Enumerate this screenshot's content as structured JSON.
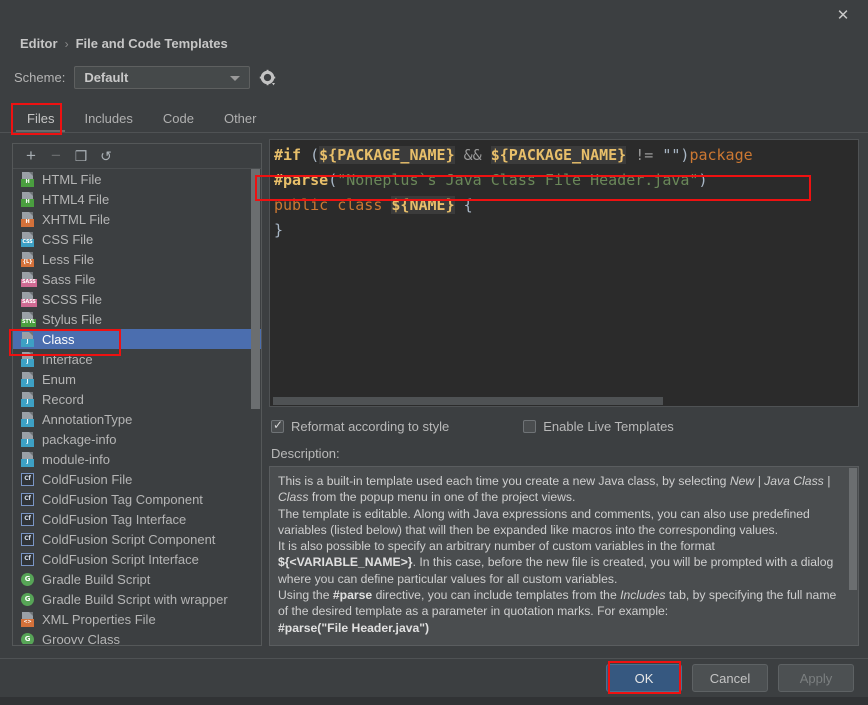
{
  "titlebar": {
    "close_icon": "close-icon",
    "close_glyph": "✕"
  },
  "breadcrumb": {
    "parent": "Editor",
    "separator": "›",
    "current": "File and Code Templates"
  },
  "scheme": {
    "label": "Scheme:",
    "value": "Default",
    "gear_icon": "gear-icon",
    "options": [
      "Default"
    ]
  },
  "tabs": [
    {
      "label": "Files",
      "active": true
    },
    {
      "label": "Includes",
      "active": false
    },
    {
      "label": "Code",
      "active": false
    },
    {
      "label": "Other",
      "active": false
    }
  ],
  "list_toolbar": [
    {
      "name": "add-button",
      "glyph": "+",
      "enabled": true
    },
    {
      "name": "remove-button",
      "glyph": "−",
      "enabled": false
    },
    {
      "name": "copy-button",
      "glyph": "❒",
      "enabled": true
    },
    {
      "name": "reset-button",
      "glyph": "↺",
      "enabled": true
    }
  ],
  "file_list": [
    {
      "label": "HTML File",
      "icon": "page",
      "tag": "H",
      "tag_color": "#4a9e3f",
      "selected": false
    },
    {
      "label": "HTML4 File",
      "icon": "page",
      "tag": "H",
      "tag_color": "#4a9e3f",
      "selected": false
    },
    {
      "label": "XHTML File",
      "icon": "page",
      "tag": "H",
      "tag_color": "#d4713a",
      "selected": false
    },
    {
      "label": "CSS File",
      "icon": "page",
      "tag": "CSS",
      "tag_color": "#3da0c4",
      "selected": false
    },
    {
      "label": "Less File",
      "icon": "page",
      "tag": "{L}",
      "tag_color": "#d4713a",
      "selected": false
    },
    {
      "label": "Sass File",
      "icon": "page",
      "tag": "SASS",
      "tag_color": "#cf6a92",
      "selected": false
    },
    {
      "label": "SCSS File",
      "icon": "page",
      "tag": "SASS",
      "tag_color": "#cf6a92",
      "selected": false
    },
    {
      "label": "Stylus File",
      "icon": "page",
      "tag": "STYL",
      "tag_color": "#4a9e3f",
      "selected": false
    },
    {
      "label": "Class",
      "icon": "page",
      "tag": "J",
      "tag_color": "#3da0c4",
      "selected": true
    },
    {
      "label": "Interface",
      "icon": "page",
      "tag": "J",
      "tag_color": "#3da0c4",
      "selected": false
    },
    {
      "label": "Enum",
      "icon": "page",
      "tag": "J",
      "tag_color": "#3da0c4",
      "selected": false
    },
    {
      "label": "Record",
      "icon": "page",
      "tag": "J",
      "tag_color": "#3da0c4",
      "selected": false
    },
    {
      "label": "AnnotationType",
      "icon": "page",
      "tag": "J",
      "tag_color": "#3da0c4",
      "selected": false
    },
    {
      "label": "package-info",
      "icon": "page",
      "tag": "J",
      "tag_color": "#3da0c4",
      "selected": false
    },
    {
      "label": "module-info",
      "icon": "page",
      "tag": "J",
      "tag_color": "#3da0c4",
      "selected": false
    },
    {
      "label": "ColdFusion File",
      "icon": "cf",
      "tag": "Cf",
      "tag_color": "#2e3236",
      "selected": false
    },
    {
      "label": "ColdFusion Tag Component",
      "icon": "cf",
      "tag": "Cf",
      "tag_color": "#2e3236",
      "selected": false
    },
    {
      "label": "ColdFusion Tag Interface",
      "icon": "cf",
      "tag": "Cf",
      "tag_color": "#2e3236",
      "selected": false
    },
    {
      "label": "ColdFusion Script Component",
      "icon": "cf",
      "tag": "Cf",
      "tag_color": "#2e3236",
      "selected": false
    },
    {
      "label": "ColdFusion Script Interface",
      "icon": "cf",
      "tag": "Cf",
      "tag_color": "#2e3236",
      "selected": false
    },
    {
      "label": "Gradle Build Script",
      "icon": "circle",
      "tag": "G",
      "tag_color": "#57a557",
      "selected": false
    },
    {
      "label": "Gradle Build Script with wrapper",
      "icon": "circle",
      "tag": "G",
      "tag_color": "#57a557",
      "selected": false
    },
    {
      "label": "XML Properties File",
      "icon": "page",
      "tag": "<>",
      "tag_color": "#d4713a",
      "selected": false
    },
    {
      "label": "Groovy Class",
      "icon": "circle",
      "tag": "G",
      "tag_color": "#57a557",
      "selected": false
    }
  ],
  "editor": {
    "lines": [
      {
        "id": "line1",
        "text": "#if (${PACKAGE_NAME} && ${PACKAGE_NAME} != \"\")package"
      },
      {
        "id": "line2",
        "text": "#parse(\"Noneplus`s Java Class File Header.java\")"
      },
      {
        "id": "line3",
        "text": "public class ${NAME} {"
      },
      {
        "id": "line4",
        "text": "}"
      }
    ],
    "l1_if": "#if",
    "l1_open": " (",
    "l1_var1": "${PACKAGE_NAME}",
    "l1_and": " && ",
    "l1_var2": "${PACKAGE_NAME}",
    "l1_neq": " != ",
    "l1_empty": "\"\"",
    "l1_close": ")",
    "l1_pkg": "package",
    "l2_parse": "#parse",
    "l2_open": "(",
    "l2_str": "\"Noneplus`s Java Class File Header.java\"",
    "l2_close": ")",
    "l3_public": "public",
    "l3_class": " class ",
    "l3_name": "${NAME}",
    "l3_brace": " {",
    "l4_brace": "}"
  },
  "checkboxes": [
    {
      "label": "Reformat according to style",
      "checked": true
    },
    {
      "label": "Enable Live Templates",
      "checked": false
    }
  ],
  "description": {
    "label": "Description:",
    "p1_a": "This is a built-in template used each time you create a new Java class, by selecting ",
    "p1_i1": "New | Java Class | Class",
    "p1_b": " from the popup menu in one of the project views.",
    "p2": "The template is editable. Along with Java expressions and comments, you can also use predefined variables (listed below) that will then be expanded like macros into the corresponding values.",
    "p3_a": "It is also possible to specify an arbitrary number of custom variables in the format ",
    "p3_b": "${<VARIABLE_NAME>}",
    "p3_c": ". In this case, before the new file is created, you will be prompted with a dialog where you can define particular values for all custom variables.",
    "p4_a": "Using the ",
    "p4_b": "#parse",
    "p4_c": " directive, you can include templates from the ",
    "p4_i": "Includes",
    "p4_d": " tab, by specifying the full name of the desired template as a parameter in quotation marks. For example:",
    "p5": "#parse(\"File Header.java\")"
  },
  "buttons": [
    {
      "label": "OK",
      "style": "primary",
      "enabled": true
    },
    {
      "label": "Cancel",
      "style": "normal",
      "enabled": true
    },
    {
      "label": "Apply",
      "style": "disabled",
      "enabled": false
    }
  ],
  "annotations": {
    "accent_red": "#ee1111",
    "selection_blue": "#4b6eaf",
    "primary_button_blue": "#365880",
    "boxes": [
      {
        "name": "highlight-files-tab"
      },
      {
        "name": "highlight-class-item"
      },
      {
        "name": "highlight-parse-line"
      },
      {
        "name": "highlight-ok-button"
      }
    ]
  }
}
